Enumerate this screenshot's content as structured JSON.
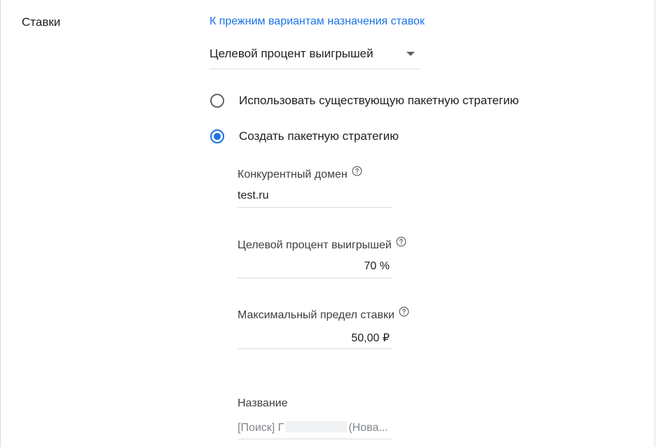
{
  "section": {
    "label": "Ставки"
  },
  "legacy_link": "К прежним вариантам назначения ставок",
  "strategy_select": {
    "value": "Целевой процент выигрышей"
  },
  "radio_options": [
    {
      "label": "Использовать существующую пакетную стратегию",
      "checked": false
    },
    {
      "label": "Создать пакетную стратегию",
      "checked": true
    }
  ],
  "fields": {
    "competitor_domain": {
      "label": "Конкурентный домен",
      "value": "test.ru"
    },
    "target_win_rate": {
      "label": "Целевой процент выигрышей",
      "value": "70 %"
    },
    "max_bid_limit": {
      "label": "Максимальный предел ставки",
      "value": "50,00 ₽"
    },
    "name": {
      "label": "Название",
      "prefix": "[Поиск] Г",
      "suffix": "(Нова..."
    }
  },
  "colors": {
    "accent": "#1a73e8",
    "text": "#202124",
    "muted": "#80868b",
    "divider": "#dadce0"
  },
  "icons": {
    "help": "help-circle-icon",
    "dropdown": "caret-down-icon"
  }
}
